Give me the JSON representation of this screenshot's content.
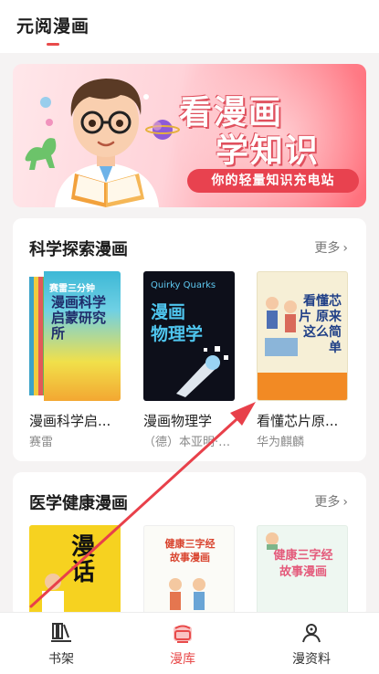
{
  "header": {
    "title": "元阅漫画"
  },
  "banner": {
    "title_line1": "看漫画",
    "title_line2": "学知识",
    "slogan": "你的轻量知识充电站"
  },
  "sections": [
    {
      "title": "科学探索漫画",
      "more": "更多",
      "books": [
        {
          "title": "漫画科学启...",
          "author": "赛雷",
          "cover_top": "赛雷三分钟",
          "cover_main": "漫画科学启蒙研究所"
        },
        {
          "title": "漫画物理学",
          "author": "（德）本亚明·兄...",
          "cover_en": "Quirky Quarks",
          "cover_main_1": "漫画",
          "cover_main_2": "物理学"
        },
        {
          "title": "看懂芯片原...",
          "author": "华为麒麟",
          "cover_main": "看懂芯片 原来这么简单"
        }
      ]
    },
    {
      "title": "医学健康漫画",
      "more": "更多",
      "books": [
        {
          "cover_main": "漫话"
        },
        {
          "cover_main": "健康三字经 故事漫画"
        },
        {
          "cover_main": "健康三字经 故事漫画"
        }
      ]
    }
  ],
  "nav": {
    "items": [
      {
        "label": "书架",
        "icon": "bookshelf-icon"
      },
      {
        "label": "漫库",
        "icon": "comic-library-icon",
        "active": true
      },
      {
        "label": "漫资料",
        "icon": "profile-icon"
      }
    ]
  },
  "colors": {
    "accent": "#e84a4a",
    "arrow": "#e8404a"
  }
}
